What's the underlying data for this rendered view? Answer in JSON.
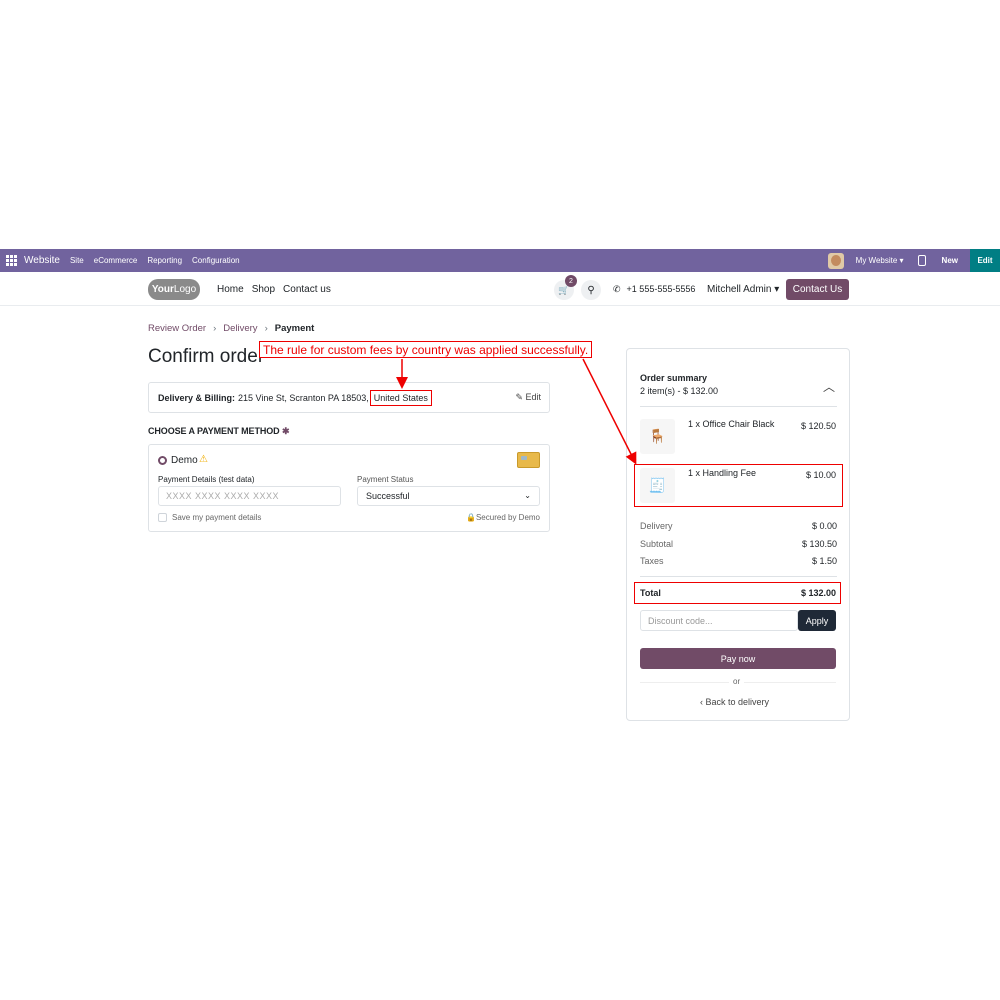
{
  "adminbar": {
    "brand": "Website",
    "menus": [
      "Site",
      "eCommerce",
      "Reporting",
      "Configuration"
    ],
    "my_website": "My Website ▾",
    "new_label": "New",
    "edit_label": "Edit"
  },
  "header": {
    "logo_bold": "Your",
    "logo_rest": "Logo",
    "nav": [
      "Home",
      "Shop",
      "Contact us"
    ],
    "cart_count": "2",
    "phone": "+1 555-555-5556",
    "user": "Mitchell Admin ▾",
    "contact_button": "Contact Us"
  },
  "breadcrumb": {
    "items": [
      "Review Order",
      "Delivery",
      "Payment"
    ],
    "separator": "›"
  },
  "page": {
    "title": "Confirm order",
    "annotation": "The rule for custom fees by country was applied successfully."
  },
  "delivery": {
    "label": "Delivery & Billing:",
    "address": "215 Vine St, Scranton PA 18503,",
    "country": "United States",
    "edit": "Edit"
  },
  "payment": {
    "section_title": "CHOOSE A PAYMENT METHOD",
    "method": "Demo",
    "details_label": "Payment Details (test data)",
    "card_placeholder": "XXXX XXXX XXXX XXXX",
    "status_label": "Payment Status",
    "status_value": "Successful",
    "save_label": "Save my payment details",
    "secured": "Secured by Demo"
  },
  "summary": {
    "title": "Order summary",
    "subtitle": "2 item(s) -  $ 132.00",
    "products": [
      {
        "name": "1 x Office Chair Black",
        "price": "$ 120.50",
        "icon": "office-chair"
      },
      {
        "name": "1 x Handling Fee",
        "price": "$ 10.00",
        "icon": "handling-fee"
      }
    ],
    "rows": [
      {
        "label": "Delivery",
        "value": "$ 0.00"
      },
      {
        "label": "Subtotal",
        "value": "$ 130.50"
      },
      {
        "label": "Taxes",
        "value": "$ 1.50"
      }
    ],
    "total_label": "Total",
    "total_value": "$ 132.00",
    "discount_placeholder": "Discount code...",
    "apply": "Apply",
    "pay_now": "Pay now",
    "or": "or",
    "back": "‹  Back to delivery"
  },
  "colors": {
    "admin_bar": "#71639e",
    "brand_primary": "#714b67",
    "annotation_red": "#ee0000"
  }
}
